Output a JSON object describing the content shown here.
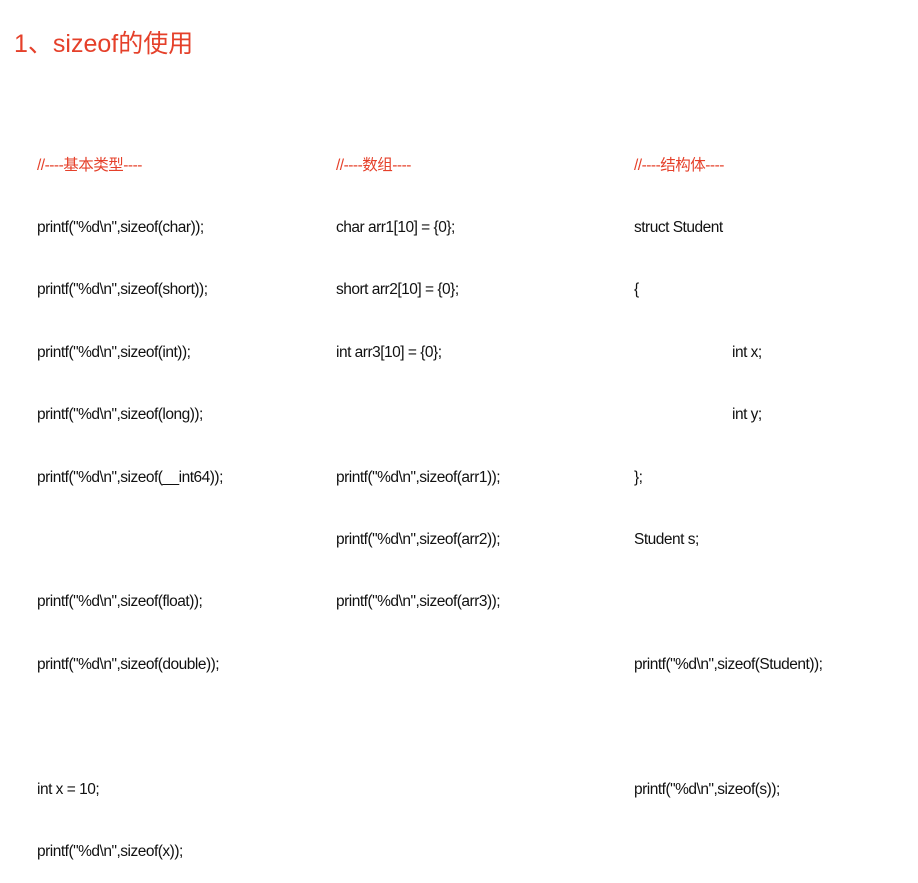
{
  "title": "1、sizeof的使用",
  "basic_types": {
    "comment": "//----基本类型----",
    "lines": [
      "printf(\"%d\\n\",sizeof(char));",
      "printf(\"%d\\n\",sizeof(short));",
      "printf(\"%d\\n\",sizeof(int));",
      "printf(\"%d\\n\",sizeof(long));",
      "printf(\"%d\\n\",sizeof(__int64));",
      "",
      "printf(\"%d\\n\",sizeof(float));",
      "printf(\"%d\\n\",sizeof(double));",
      "",
      "int x = 10;",
      "printf(\"%d\\n\",sizeof(x));"
    ]
  },
  "arrays": {
    "comment": "//----数组----",
    "lines": [
      "char arr1[10] = {0};",
      "short arr2[10] = {0};",
      "int arr3[10] = {0};",
      "",
      "printf(\"%d\\n\",sizeof(arr1));",
      "printf(\"%d\\n\",sizeof(arr2));",
      "printf(\"%d\\n\",sizeof(arr3));"
    ]
  },
  "structs": {
    "comment": "//----结构体----",
    "lines": [
      "struct Student",
      "{",
      "int x;",
      "int y;",
      "};",
      "Student s;",
      "",
      "printf(\"%d\\n\",sizeof(Student));",
      "",
      "printf(\"%d\\n\",sizeof(s));"
    ]
  }
}
